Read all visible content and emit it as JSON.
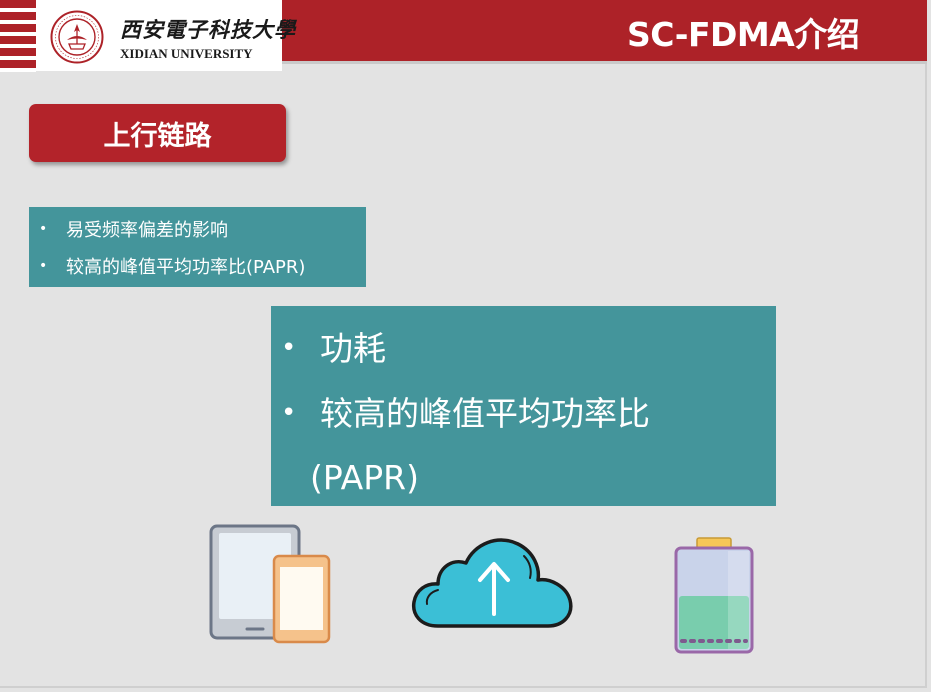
{
  "header": {
    "title": "SC-FDMA介绍",
    "logo": {
      "cn_text": "西安電子科技大學",
      "en_text": "XIDIAN UNIVERSITY"
    }
  },
  "section_label": "上行链路",
  "small_box": {
    "items": [
      {
        "bullet": "•",
        "text": "易受频率偏差的影响"
      },
      {
        "bullet": "•",
        "text": "较高的峰值平均功率比(PAPR)"
      }
    ]
  },
  "big_box": {
    "items": [
      {
        "bullet": "•",
        "text": "功耗"
      },
      {
        "bullet": "•",
        "text": "较高的峰值平均功率比",
        "continuation": "(PAPR)"
      }
    ]
  },
  "icons": [
    "tablet-phone-icon",
    "cloud-upload-icon",
    "battery-icon"
  ],
  "colors": {
    "header_red": "#ad2228",
    "teal": "#44959b",
    "slide_bg": "#e3e3e3"
  }
}
